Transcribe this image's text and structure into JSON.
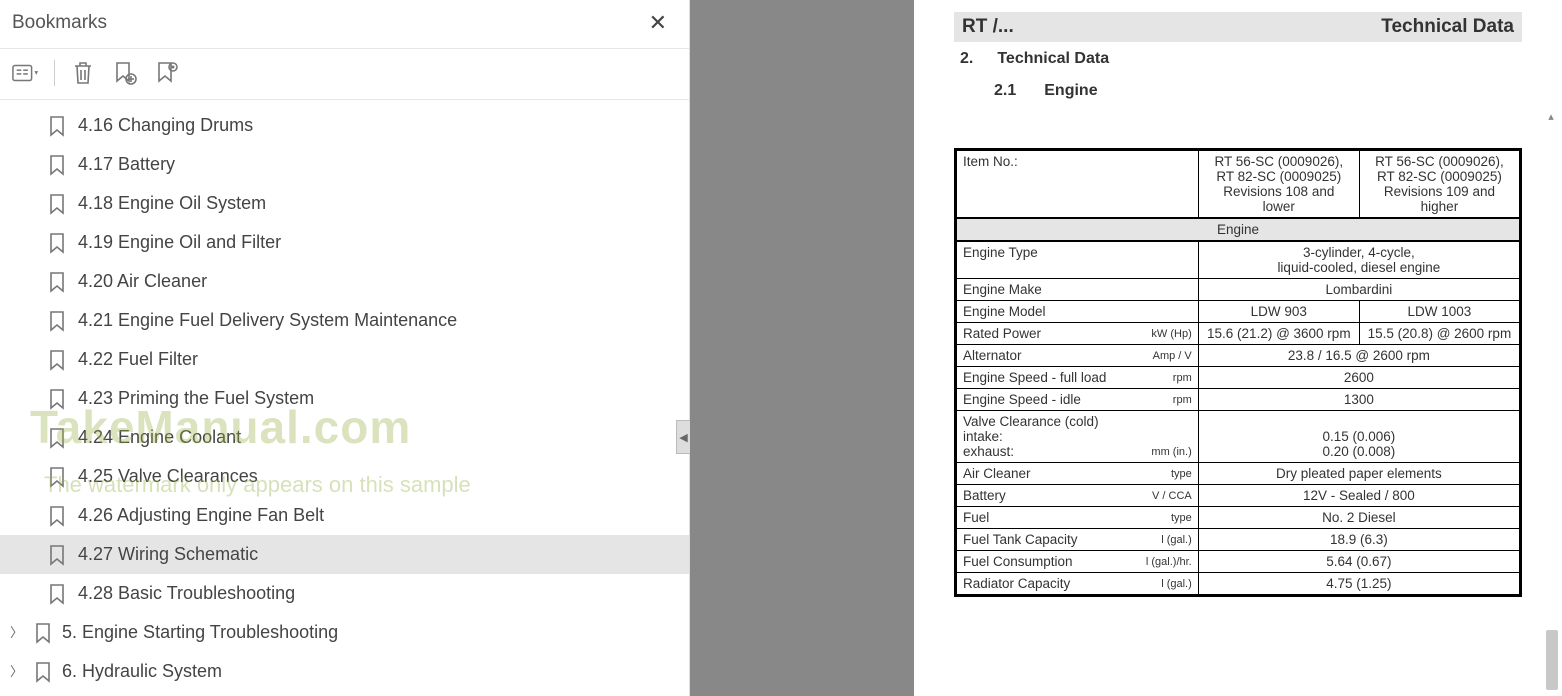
{
  "sidebar": {
    "title": "Bookmarks",
    "items": [
      {
        "label": "4.16 Changing Drums",
        "selected": false
      },
      {
        "label": "4.17 Battery",
        "selected": false
      },
      {
        "label": "4.18 Engine Oil System",
        "selected": false
      },
      {
        "label": "4.19 Engine Oil and Filter",
        "selected": false
      },
      {
        "label": "4.20 Air Cleaner",
        "selected": false
      },
      {
        "label": "4.21 Engine Fuel Delivery System Maintenance",
        "selected": false
      },
      {
        "label": "4.22 Fuel Filter",
        "selected": false
      },
      {
        "label": "4.23 Priming the Fuel System",
        "selected": false
      },
      {
        "label": "4.24 Engine Coolant",
        "selected": false
      },
      {
        "label": "4.25 Valve Clearances",
        "selected": false
      },
      {
        "label": "4.26 Adjusting Engine Fan Belt",
        "selected": false
      },
      {
        "label": "4.27 Wiring Schematic",
        "selected": true
      },
      {
        "label": "4.28 Basic Troubleshooting",
        "selected": false
      }
    ],
    "parents": [
      {
        "label": "5. Engine Starting Troubleshooting"
      },
      {
        "label": "6. Hydraulic System"
      }
    ]
  },
  "watermark": {
    "main": "TakeManual.com",
    "sub": "The watermark only appears on this sample"
  },
  "page": {
    "header_left": "RT /...",
    "header_right": "Technical Data",
    "section_num": "2.",
    "section_title": "Technical Data",
    "subsection_num": "2.1",
    "subsection_title": "Engine"
  },
  "table": {
    "item_no_label": "Item No.:",
    "col1_lines": [
      "RT 56-SC (0009026),",
      "RT 82-SC (0009025)",
      "Revisions 108 and",
      "lower"
    ],
    "col2_lines": [
      "RT 56-SC (0009026),",
      "RT 82-SC (0009025)",
      "Revisions 109 and",
      "higher"
    ],
    "section_label": "Engine",
    "rows": [
      {
        "label": "Engine Type",
        "unit": "",
        "span": true,
        "val": "3-cylinder, 4-cycle,\nliquid-cooled, diesel engine"
      },
      {
        "label": "Engine Make",
        "unit": "",
        "span": true,
        "val": "Lombardini"
      },
      {
        "label": "Engine Model",
        "unit": "",
        "span": false,
        "v1": "LDW 903",
        "v2": "LDW 1003"
      },
      {
        "label": "Rated Power",
        "unit": "kW (Hp)",
        "span": false,
        "v1": "15.6 (21.2) @ 3600 rpm",
        "v2": "15.5 (20.8) @ 2600 rpm"
      },
      {
        "label": "Alternator",
        "unit": "Amp / V",
        "span": true,
        "val": "23.8 / 16.5 @ 2600 rpm"
      },
      {
        "label": "Engine Speed - full load",
        "unit": "rpm",
        "span": true,
        "val": "2600"
      },
      {
        "label": "Engine Speed - idle",
        "unit": "rpm",
        "span": true,
        "val": "1300"
      },
      {
        "label": "Valve Clearance (cold)\n intake:\n exhaust:",
        "unit": "mm (in.)",
        "span": true,
        "val": "\n0.15 (0.006)\n0.20 (0.008)"
      },
      {
        "label": "Air Cleaner",
        "unit": "type",
        "span": true,
        "val": "Dry pleated paper elements"
      },
      {
        "label": "Battery",
        "unit": "V / CCA",
        "span": true,
        "val": "12V - Sealed / 800"
      },
      {
        "label": "Fuel",
        "unit": "type",
        "span": true,
        "val": "No. 2 Diesel"
      },
      {
        "label": "Fuel Tank Capacity",
        "unit": "l (gal.)",
        "span": true,
        "val": "18.9 (6.3)"
      },
      {
        "label": "Fuel Consumption",
        "unit": "l (gal.)/hr.",
        "span": true,
        "val": "5.64 (0.67)"
      },
      {
        "label": "Radiator Capacity",
        "unit": "l (gal.)",
        "span": true,
        "val": "4.75 (1.25)"
      }
    ]
  }
}
